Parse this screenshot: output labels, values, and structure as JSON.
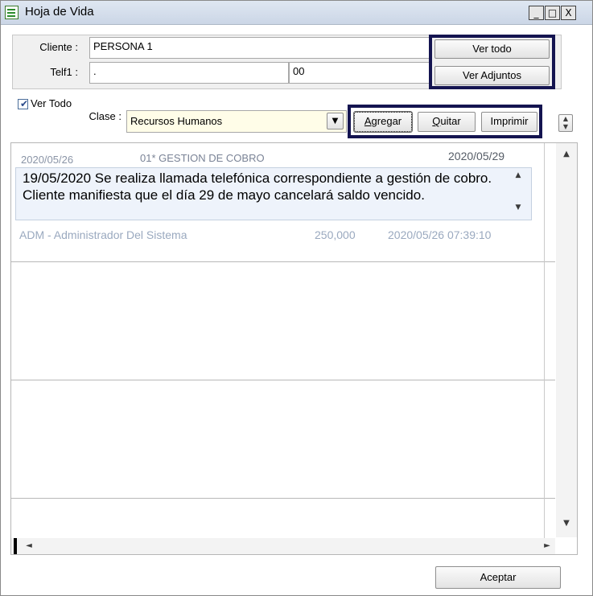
{
  "window": {
    "title": "Hoja de Vida",
    "controls": {
      "minimize": "_",
      "restore": "□",
      "close": "X"
    }
  },
  "client": {
    "cliente_label": "Cliente :",
    "cliente_value": "PERSONA 1",
    "telf_label": "Telf1 :",
    "telf_value": ".",
    "telf_ext_value": "00"
  },
  "buttons": {
    "ver_todo": "Ver todo",
    "ver_adjuntos": "Ver Adjuntos",
    "agregar": "Agregar",
    "quitar": "Quitar",
    "imprimir": "Imprimir",
    "aceptar": "Aceptar"
  },
  "filter": {
    "ver_todo_label": "Ver Todo",
    "ver_todo_checked": true,
    "clase_label": "Clase :",
    "clase_value": "Recursos Humanos"
  },
  "records": [
    {
      "date": "2020/05/26",
      "category": "01* GESTION DE COBRO",
      "due_date": "2020/05/29",
      "note": "19/05/2020 Se realiza llamada telefónica correspondiente a gestión de cobro. Cliente manifiesta que el día 29 de mayo cancelará saldo vencido.",
      "user": "ADM - Administrador Del Sistema",
      "amount": "250,000",
      "timestamp": "2020/05/26 07:39:10"
    }
  ],
  "icons": {
    "scroll_up": "▲",
    "scroll_down": "▼",
    "scroll_left": "◄",
    "scroll_right": "►",
    "dropdown": "▼",
    "spinner_up": "▲",
    "spinner_down": "▼"
  },
  "colors": {
    "frame_highlight": "#141450",
    "clase_field_bg": "#fffde8",
    "note_bg": "#eef3fb"
  }
}
